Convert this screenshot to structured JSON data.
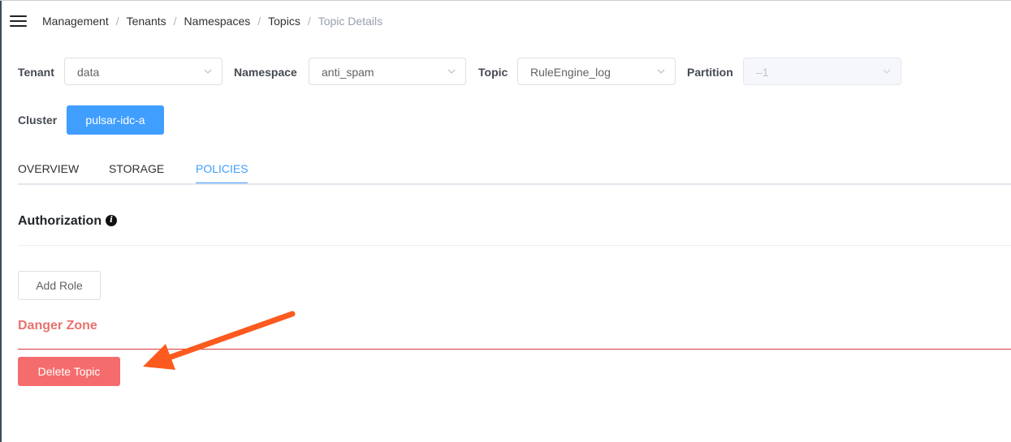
{
  "breadcrumb": {
    "items": [
      "Management",
      "Tenants",
      "Namespaces",
      "Topics"
    ],
    "current": "Topic Details",
    "separator": "/"
  },
  "selectors": {
    "tenant": {
      "label": "Tenant",
      "value": "data"
    },
    "namespace": {
      "label": "Namespace",
      "value": "anti_spam"
    },
    "topic": {
      "label": "Topic",
      "value": "RuleEngine_log"
    },
    "partition": {
      "label": "Partition",
      "value": "–1",
      "disabled": true
    }
  },
  "cluster": {
    "label": "Cluster",
    "value": "pulsar-idc-a"
  },
  "tabs": [
    {
      "label": "OVERVIEW",
      "active": false
    },
    {
      "label": "STORAGE",
      "active": false
    },
    {
      "label": "POLICIES",
      "active": true
    }
  ],
  "authorization": {
    "title": "Authorization",
    "info_icon": "info-icon",
    "add_role_label": "Add Role"
  },
  "danger_zone": {
    "title": "Danger Zone",
    "delete_label": "Delete Topic"
  },
  "annotation": {
    "icon": "arrow-icon",
    "color": "#fc5a1f"
  },
  "colors": {
    "primary": "#409eff",
    "danger": "#f56c6c",
    "danger_text": "#e8726e",
    "danger_line": "#d9393a"
  }
}
